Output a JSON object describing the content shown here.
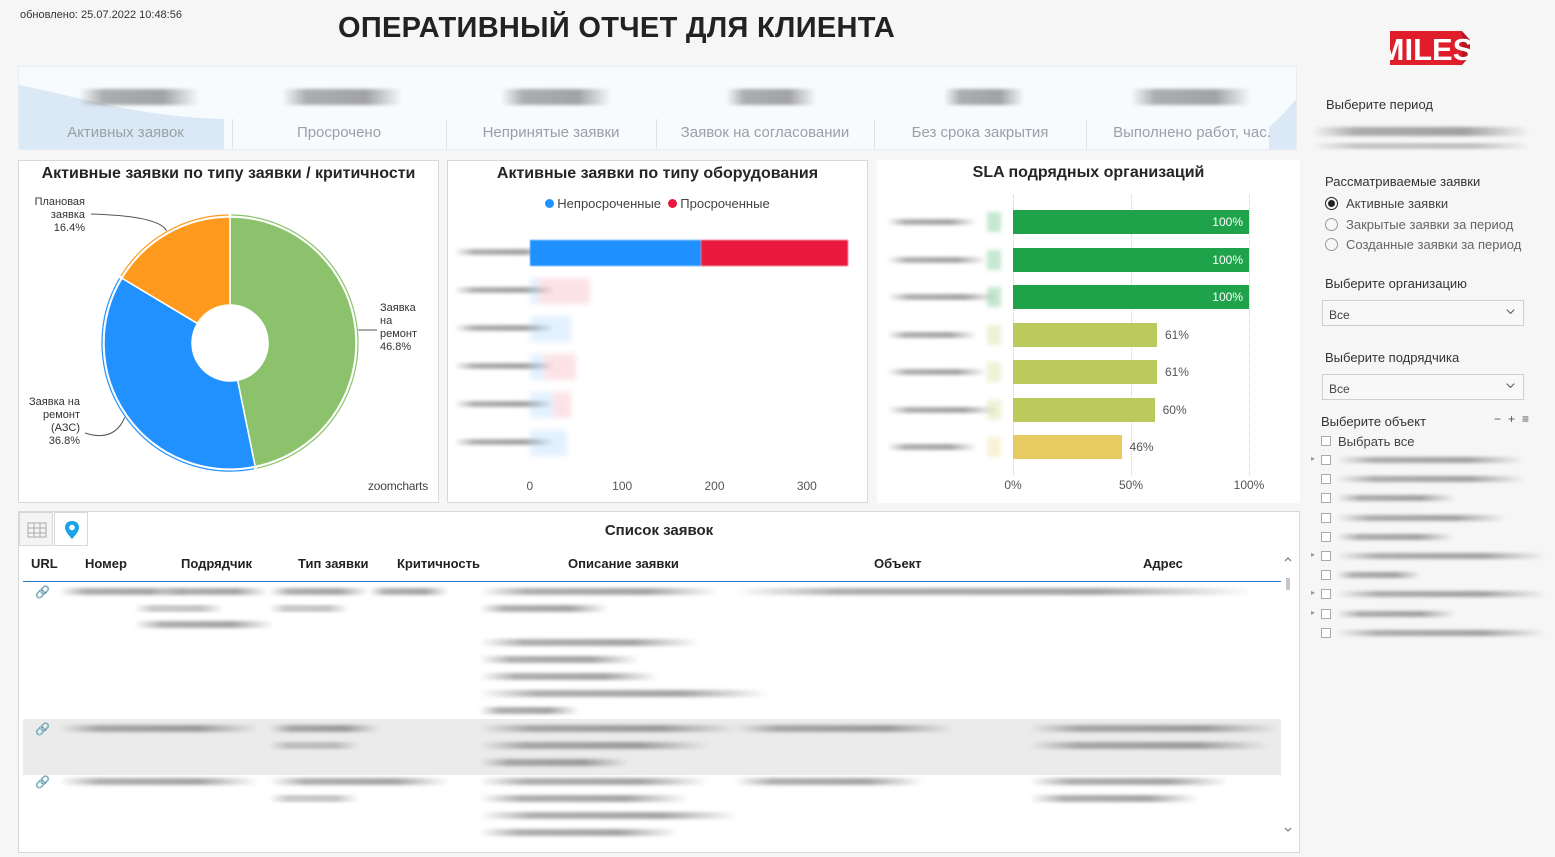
{
  "header": {
    "updated": "обновлено: 25.07.2022 10:48:56",
    "title": "ОПЕРАТИВНЫЙ ОТЧЕТ ДЛЯ КЛИЕНТА",
    "logo_text": "MILES"
  },
  "kpis": [
    {
      "label": "Активных заявок"
    },
    {
      "label": "Просрочено"
    },
    {
      "label": "Непринятые заявки"
    },
    {
      "label": "Заявок на согласовании"
    },
    {
      "label": "Без срока закрытия"
    },
    {
      "label": "Выполнено работ, час."
    }
  ],
  "pie_panel": {
    "title": "Активные заявки по типу заявки / критичности",
    "watermark": "zoomcharts"
  },
  "bar_panel": {
    "title": "Активные заявки по типу оборудования"
  },
  "sla_panel": {
    "title": "SLA подрядных организаций"
  },
  "chart_data": [
    {
      "type": "pie",
      "title": "Активные заявки по типу заявки / критичности",
      "slices": [
        {
          "name": "Заявка на ремонт",
          "value": 46.8,
          "label": "46.8%",
          "color": "#8cc26b"
        },
        {
          "name": "Заявка на ремонт (АЗС)",
          "value": 36.8,
          "label": "36.8%",
          "color": "#2191ff"
        },
        {
          "name": "Плановая заявка",
          "value": 16.4,
          "label": "16.4%",
          "color": "#ff9a1f"
        }
      ]
    },
    {
      "type": "bar",
      "title": "Активные заявки по типу оборудования",
      "orientation": "horizontal",
      "stacked": true,
      "legend": [
        "Непросроченные",
        "Просроченные"
      ],
      "legend_placement": "top",
      "colors": {
        "Непросроченные": "#1e90ff",
        "Просроченные": "#e8193c"
      },
      "xlim": [
        -80,
        350
      ],
      "xticks": [
        "0",
        "100",
        "200",
        "300"
      ],
      "rows": [
        {
          "Непросроченные": 185,
          "Просроченные": 160
        },
        {
          "Непросроченные": 10,
          "Просроченные": 55
        },
        {
          "Непросроченные": 45,
          "Просроченные": 0
        },
        {
          "Непросроченные": 15,
          "Просроченные": 35
        },
        {
          "Непросроченные": 25,
          "Просроченные": 20
        },
        {
          "Непросроченные": 40,
          "Просроченные": 0
        }
      ]
    },
    {
      "type": "bar",
      "title": "SLA подрядных организаций",
      "orientation": "horizontal",
      "xlim": [
        0,
        100
      ],
      "xticks": [
        "0%",
        "50%",
        "100%"
      ],
      "grid": true,
      "values": [
        100,
        100,
        100,
        61,
        61,
        60,
        46
      ],
      "labels": [
        "100%",
        "100%",
        "100%",
        "61%",
        "61%",
        "60%",
        "46%"
      ],
      "colors": [
        "#1fa34a",
        "#1fa34a",
        "#1fa34a",
        "#bcc95d",
        "#bcc95d",
        "#bcc95d",
        "#e6cb62"
      ]
    }
  ],
  "table": {
    "title": "Список заявок",
    "view_icons": [
      "table-icon",
      "map-pin-icon"
    ],
    "columns": [
      "URL",
      "Номер",
      "Подрядчик",
      "Тип заявки",
      "Критичность",
      "Описание заявки",
      "Объект",
      "Адрес"
    ],
    "link_glyph": "🔗"
  },
  "filters": {
    "period_label": "Выберите период",
    "requests_label": "Рассматриваемые заявки",
    "radios": [
      {
        "label": "Активные заявки",
        "selected": true
      },
      {
        "label": "Закрытые заявки за период",
        "selected": false
      },
      {
        "label": "Созданные заявки за период",
        "selected": false
      }
    ],
    "org_label": "Выберите организацию",
    "org_value": "Все",
    "contractor_label": "Выберите подрядчика",
    "contractor_value": "Все",
    "object_label": "Выберите объект",
    "select_all": "Выбрать все",
    "tools": [
      "−",
      "+",
      "≡"
    ]
  }
}
